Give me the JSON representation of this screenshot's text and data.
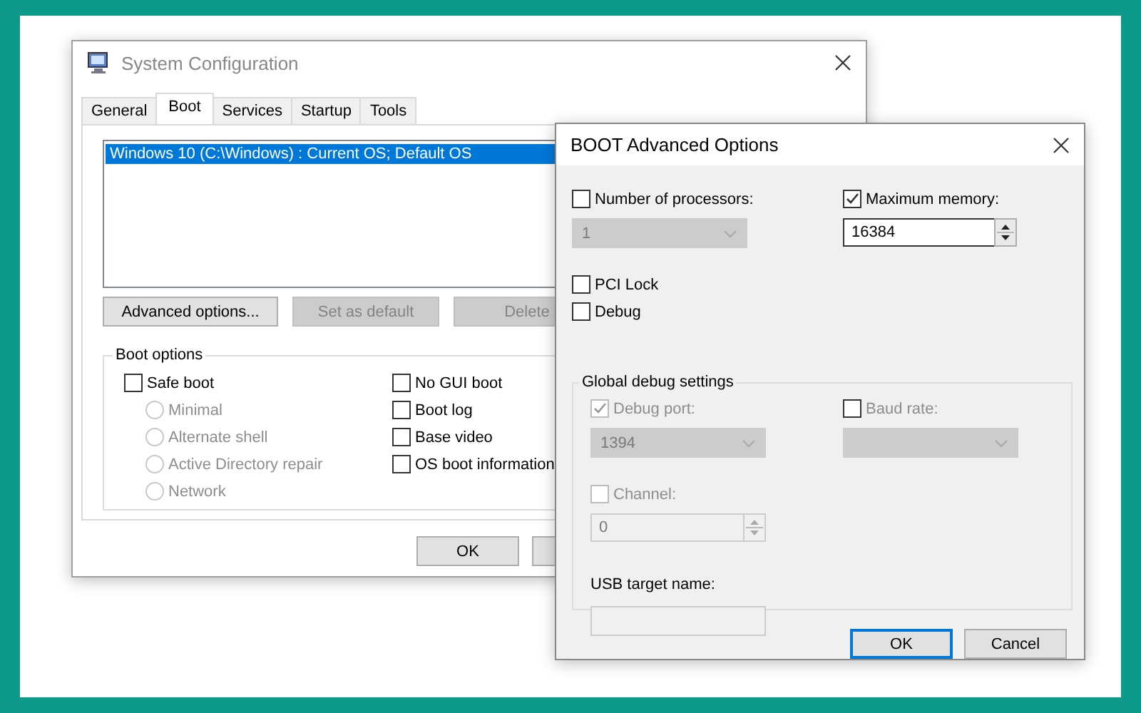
{
  "window": {
    "title": "System Configuration"
  },
  "tabs": [
    {
      "label": "General",
      "selected": false
    },
    {
      "label": "Boot",
      "selected": true
    },
    {
      "label": "Services",
      "selected": false
    },
    {
      "label": "Startup",
      "selected": false
    },
    {
      "label": "Tools",
      "selected": false
    }
  ],
  "boot_entries": [
    {
      "label": "Windows 10 (C:\\Windows) : Current OS; Default OS",
      "selected": true
    }
  ],
  "entry_buttons": [
    {
      "label": "Advanced options...",
      "disabled": false
    },
    {
      "label": "Set as default",
      "disabled": true
    },
    {
      "label": "Delete",
      "disabled": true
    }
  ],
  "boot_options": {
    "title": "Boot options",
    "safe_boot": {
      "label": "Safe boot",
      "checked": false
    },
    "safe_boot_modes": [
      {
        "label": "Minimal",
        "selected": false,
        "disabled": true
      },
      {
        "label": "Alternate shell",
        "selected": false,
        "disabled": true
      },
      {
        "label": "Active Directory repair",
        "selected": false,
        "disabled": true
      },
      {
        "label": "Network",
        "selected": false,
        "disabled": true
      }
    ],
    "flags": [
      {
        "label": "No GUI boot",
        "checked": false
      },
      {
        "label": "Boot log",
        "checked": false
      },
      {
        "label": "Base video",
        "checked": false
      },
      {
        "label": "OS boot information",
        "checked": false
      }
    ]
  },
  "buttons": [
    {
      "kind": "text",
      "label": "OK"
    },
    {
      "kind": "blank"
    }
  ],
  "advanced": {
    "title": "BOOT Advanced Options",
    "processors": {
      "label": "Number of processors:",
      "checked": false,
      "disabled": true,
      "value": "1"
    },
    "max_memory": {
      "label": "Maximum memory:",
      "checked": true,
      "disabled": false,
      "value": "16384"
    },
    "options": [
      {
        "label": "PCI Lock",
        "checked": false
      },
      {
        "label": "Debug",
        "checked": false
      }
    ],
    "debug": {
      "title": "Global debug settings",
      "debug_port": {
        "label": "Debug port:",
        "checked": true,
        "disabled": true,
        "value": "1394"
      },
      "baud_rate": {
        "label": "Baud rate:",
        "checked": false,
        "disabled": true
      },
      "channel": {
        "label": "Channel:",
        "checked": false,
        "disabled": true,
        "value": "0"
      },
      "usb_target": {
        "label": "USB target name:",
        "disabled": true
      }
    },
    "buttons": [
      {
        "label": "OK",
        "focused": true
      },
      {
        "label": "Cancel",
        "focused": false
      }
    ]
  }
}
